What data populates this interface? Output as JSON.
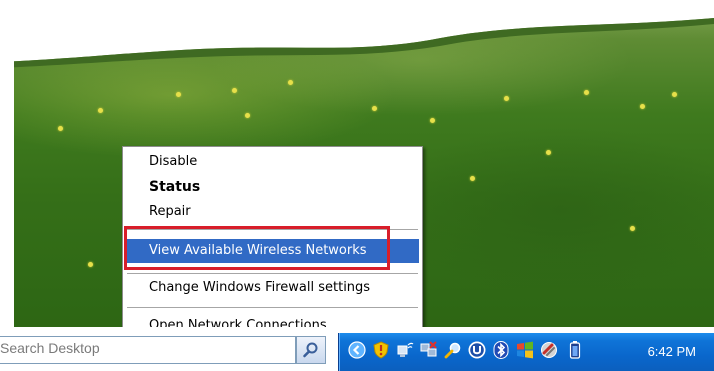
{
  "context_menu": {
    "items": [
      {
        "label": "Disable",
        "bold": false
      },
      {
        "label": "Status",
        "bold": true
      },
      {
        "label": "Repair",
        "bold": false
      },
      {
        "label": "View Available Wireless Networks",
        "bold": false,
        "highlighted": true
      },
      {
        "label": "Change Windows Firewall settings",
        "bold": false
      },
      {
        "label": "Open Network Connections",
        "bold": false
      }
    ],
    "highlight_color": "#316ac5",
    "annotation_color": "#d81e2a"
  },
  "taskbar": {
    "search": {
      "placeholder": "Search Desktop"
    },
    "tray": {
      "icons": [
        "collapse-arrow-icon",
        "security-shield-icon",
        "wireless-network-icon",
        "network-connections-icon",
        "search-magnifier-icon",
        "u-app-icon",
        "bluetooth-icon",
        "windows-flag-icon",
        "tools-icon",
        "battery-icon"
      ],
      "clock": "6:42 PM"
    },
    "tray_color": "#0a67cc"
  }
}
